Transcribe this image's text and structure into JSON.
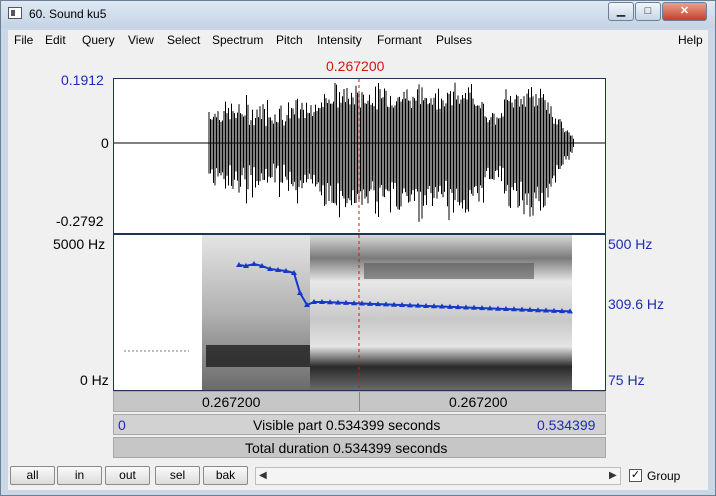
{
  "window": {
    "title": "60. Sound ku5",
    "min_icon": "minimize-icon",
    "max_icon": "maximize-icon",
    "close_icon": "close-icon"
  },
  "menu": [
    "File",
    "Edit",
    "Query",
    "View",
    "Select",
    "Spectrum",
    "Pitch",
    "Intensity",
    "Formant",
    "Pulses"
  ],
  "help": "Help",
  "cursor": {
    "time": "0.267200"
  },
  "wave": {
    "max": "0.1912",
    "zero": "0",
    "min": "-0.2792"
  },
  "spectrogram": {
    "top_freq": "5000 Hz",
    "bottom_freq": "0 Hz"
  },
  "pitch_axis": {
    "top": "500 Hz",
    "current": "309.6 Hz",
    "bottom": "75 Hz"
  },
  "time_bar": {
    "left": "0.267200",
    "right": "0.267200"
  },
  "visible": {
    "start": "0",
    "label": "Visible part 0.534399 seconds",
    "end": "0.534399"
  },
  "total": {
    "label": "Total duration 0.534399 seconds"
  },
  "buttons": {
    "all": "all",
    "in": "in",
    "out": "out",
    "sel": "sel",
    "bak": "bak"
  },
  "group": {
    "label": "Group",
    "checked": "✓"
  },
  "colors": {
    "pitch": "#1438c8",
    "cursor": "#d0180b",
    "axis_text": "#1c2bb3"
  }
}
